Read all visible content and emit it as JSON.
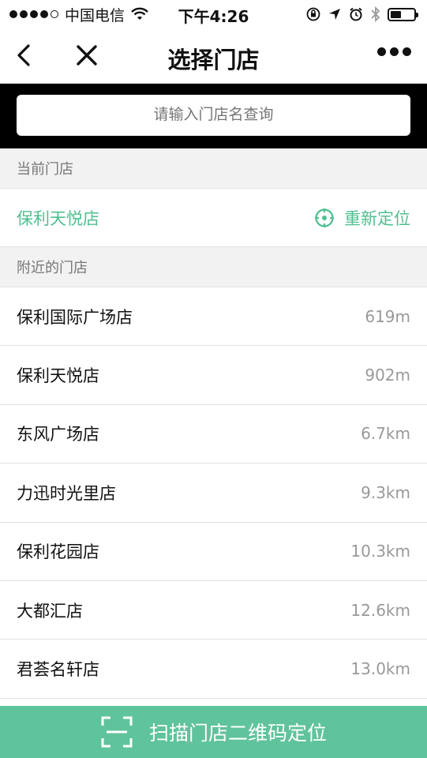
{
  "status_bar": {
    "carrier": "中国电信",
    "time": "下午4:26"
  },
  "nav": {
    "title": "选择门店"
  },
  "search": {
    "placeholder": "请输入门店名查询"
  },
  "current_section": {
    "header": "当前门店",
    "store_name": "保利天悦店",
    "relocate_label": "重新定位"
  },
  "nearby_section": {
    "header": "附近的门店",
    "stores": [
      {
        "name": "保利国际广场店",
        "distance": "619m"
      },
      {
        "name": "保利天悦店",
        "distance": "902m"
      },
      {
        "name": "东风广场店",
        "distance": "6.7km"
      },
      {
        "name": "力迅时光里店",
        "distance": "9.3km"
      },
      {
        "name": "保利花园店",
        "distance": "10.3km"
      },
      {
        "name": "大都汇店",
        "distance": "12.6km"
      },
      {
        "name": "君荟名轩店",
        "distance": "13.0km"
      }
    ]
  },
  "scan_bar": {
    "label": "扫描门店二维码定位"
  },
  "colors": {
    "accent": "#4fbf8f",
    "scan_bar": "#5fc39b"
  }
}
